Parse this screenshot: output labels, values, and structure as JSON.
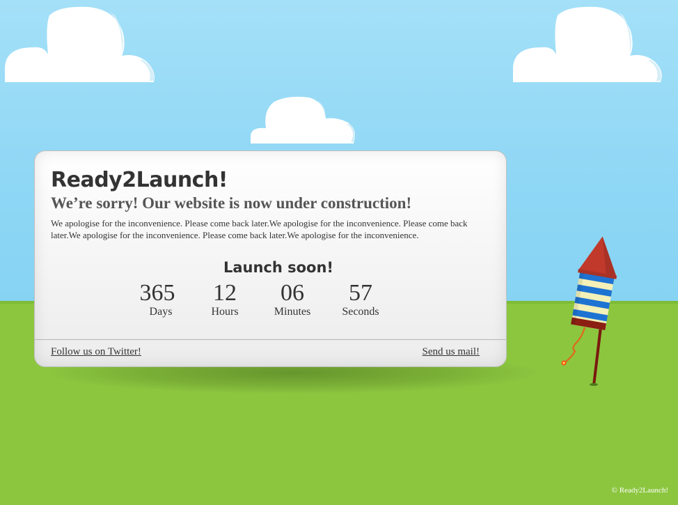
{
  "hero": {
    "brand": "Ready2Launch!",
    "headline": "We’re sorry! Our website is now under construction!",
    "message": "We apologise for the inconvenience. Please come back later.We apologise for the inconvenience. Please come back later.We apologise for the inconvenience. Please come back later.We apologise for the inconvenience."
  },
  "countdown": {
    "title": "Launch soon!",
    "units": [
      {
        "value": "365",
        "label": "Days"
      },
      {
        "value": "12",
        "label": "Hours"
      },
      {
        "value": "06",
        "label": "Minutes"
      },
      {
        "value": "57",
        "label": "Seconds"
      }
    ]
  },
  "links": {
    "twitter": "Follow us on Twitter!",
    "mail": "Send us mail!"
  },
  "footer": {
    "copyright": "© Ready2Launch!"
  },
  "colors": {
    "sky": "#8fd7f5",
    "grass": "#8cc63f",
    "rocket_cap": "#c0392b",
    "rocket_stripe_blue": "#1e73d2",
    "rocket_stripe_cream": "#f3f0b8"
  }
}
